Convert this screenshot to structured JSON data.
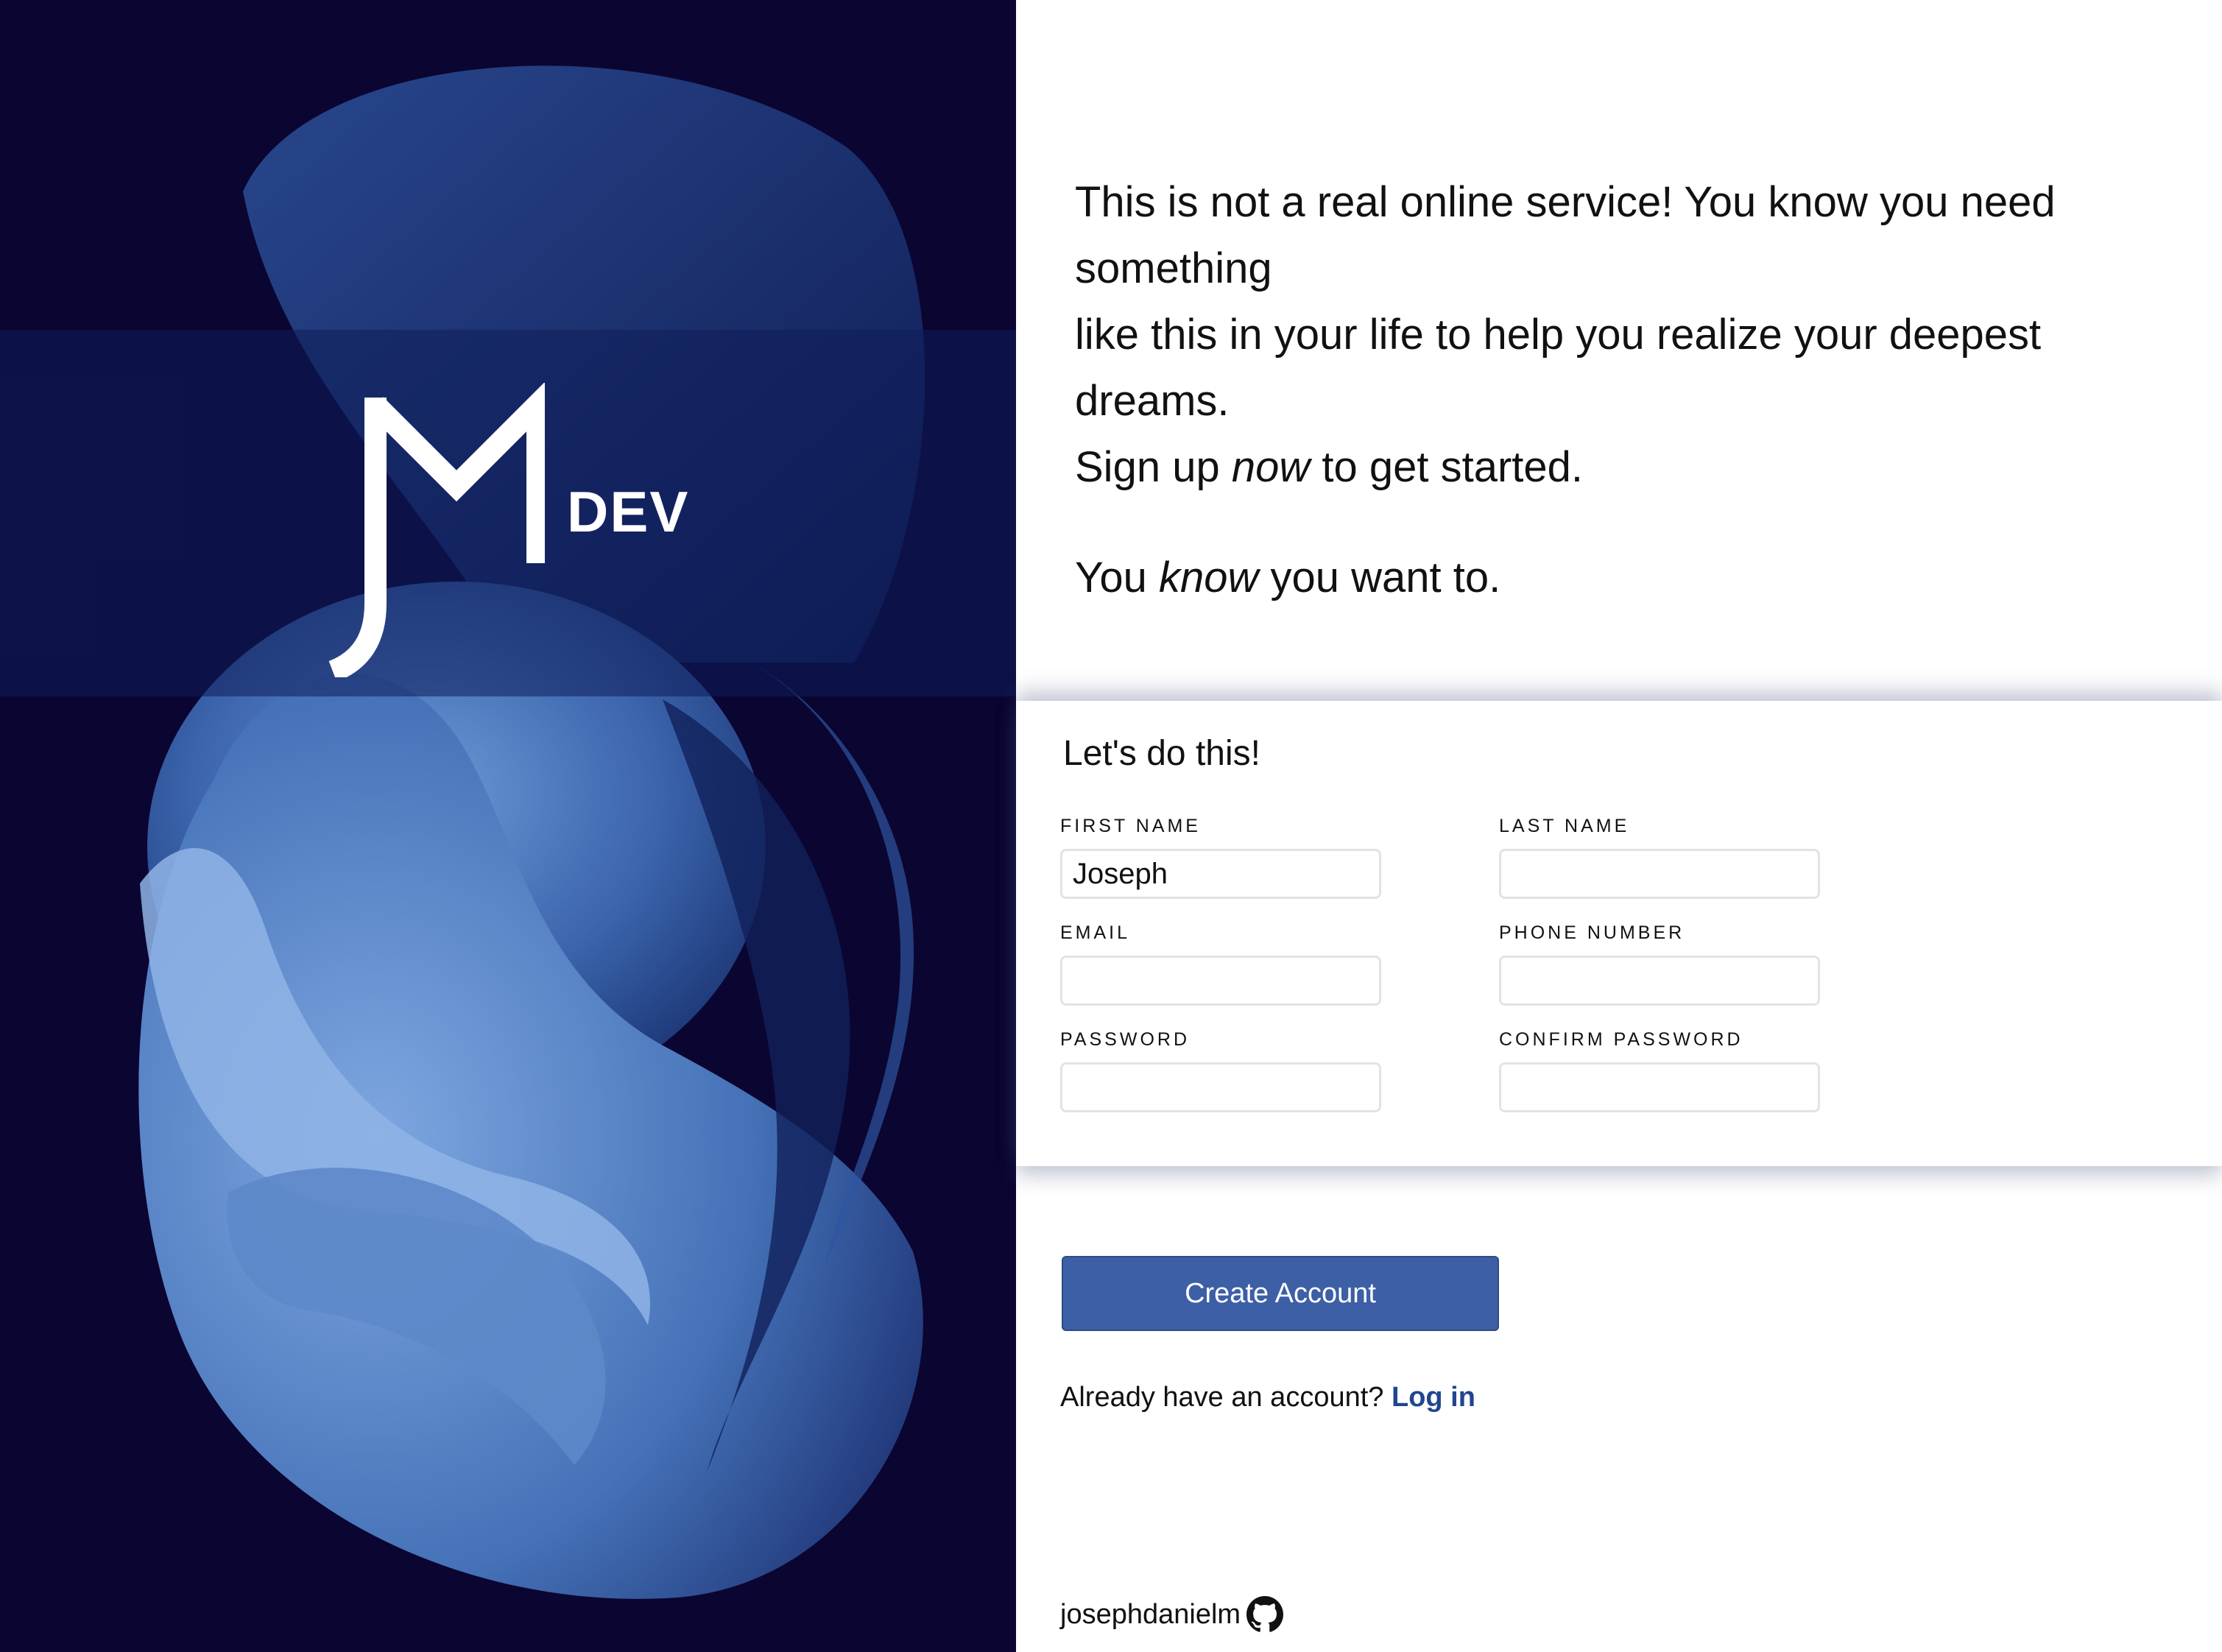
{
  "branding": {
    "logo_text": "DEV",
    "logo_mark": "JM"
  },
  "intro": {
    "line1": "This is not a real online service! You know you need something",
    "line2": "like this in your life to help you realize your deepest dreams.",
    "line3_before": "Sign up ",
    "line3_emphasis": "now",
    "line3_after": " to get started.",
    "line4_before": "You ",
    "line4_emphasis": "know",
    "line4_after": " you want to."
  },
  "form": {
    "title": "Let's do this!",
    "fields": {
      "first_name": {
        "label": "First Name",
        "value": "Joseph"
      },
      "last_name": {
        "label": "Last Name",
        "value": ""
      },
      "email": {
        "label": "Email",
        "value": ""
      },
      "phone_number": {
        "label": "Phone Number",
        "value": ""
      },
      "password": {
        "label": "Password",
        "value": ""
      },
      "confirm_password": {
        "label": "Confirm Password",
        "value": ""
      }
    }
  },
  "actions": {
    "create_account": "Create Account",
    "login_prompt": "Already have an account?",
    "login_link": "Log in"
  },
  "footer": {
    "username": "josephdanielm",
    "icon": "github-icon"
  },
  "colors": {
    "sidebar_bg": "#0b0531",
    "button_bg": "#3d5fa5",
    "link": "#20468f"
  }
}
